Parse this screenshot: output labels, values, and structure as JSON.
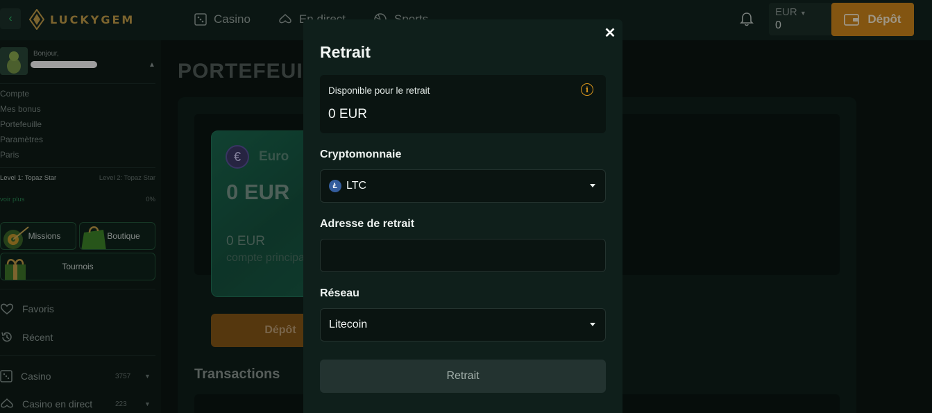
{
  "header": {
    "logo_text": "LUCKYGEM",
    "nav": [
      {
        "label": "Casino",
        "icon": "dice-icon"
      },
      {
        "label": "En direct",
        "icon": "cards-icon"
      },
      {
        "label": "Sports",
        "icon": "ball-icon"
      }
    ],
    "currency_code": "EUR",
    "balance": "0",
    "deposit_label": "Dépôt"
  },
  "sidebar": {
    "greeting": "Bonjour,",
    "links": [
      "Compte",
      "Mes bonus",
      "Portefeuille",
      "Paramètres",
      "Paris"
    ],
    "level_current": "Level 1: Topaz Star",
    "level_next": "Level 2: Topaz Star",
    "see_more": "voir plus",
    "progress": "0%",
    "promos": {
      "missions": "Missions",
      "shop": "Boutique",
      "tournaments": "Tournois"
    },
    "menu": {
      "favorites": "Favoris",
      "recent": "Récent",
      "casino": {
        "label": "Casino",
        "count": "3757"
      },
      "live_casino": {
        "label": "Casino en direct",
        "count": "223"
      }
    }
  },
  "main": {
    "page_title": "PORTEFEUILLE",
    "card": {
      "currency_name": "Euro",
      "currency_symbol": "€",
      "balance": "0 EUR",
      "sub_balance": "0 EUR",
      "sub_label": "compte principal"
    },
    "deposit_label": "Dépôt",
    "transactions_title": "Transactions"
  },
  "modal": {
    "title": "Retrait",
    "available_label": "Disponible pour le retrait",
    "available_value": "0 EUR",
    "crypto_label": "Cryptomonnaie",
    "crypto_value": "LTC",
    "address_label": "Adresse de retrait",
    "address_value": "",
    "network_label": "Réseau",
    "network_value": "Litecoin",
    "submit_label": "Retrait"
  },
  "colors": {
    "accent": "#d48a1c",
    "brand_green": "#2bbf6a",
    "background": "#0c1512"
  }
}
